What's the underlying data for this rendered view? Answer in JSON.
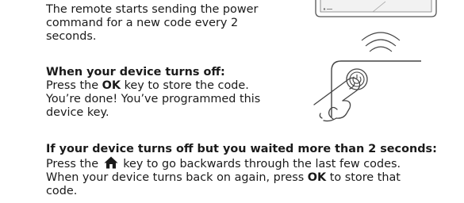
{
  "step1": {
    "text": "The remote starts sending the power command for a new code every 2 seconds."
  },
  "step2": {
    "heading": "When your device turns off:",
    "line_a_pre": "Press the ",
    "ok_key": "OK",
    "line_a_post": " key to store the code.",
    "line_b": "You’re done! You’ve programmed this device key."
  },
  "step3": {
    "heading": "If your device turns off but you waited more than 2 seconds:",
    "pre": "Press the ",
    "home_icon": "home-icon",
    "mid": " key to go backwards through the last few codes. When your device turns back on again, press ",
    "ok_key": "OK",
    "post": " to store that code."
  },
  "illustration": {
    "icons": [
      "tv-icon",
      "signal-waves-icon",
      "remote-power-button-icon",
      "finger-pressing-icon"
    ]
  }
}
